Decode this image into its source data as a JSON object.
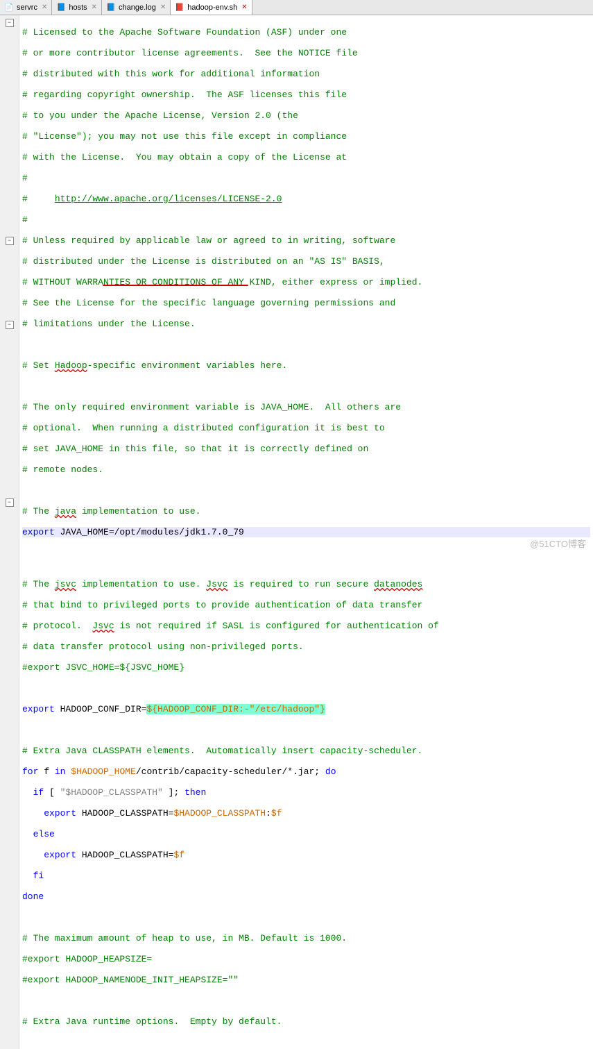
{
  "tabs": [
    {
      "label": "servrc",
      "active": false
    },
    {
      "label": "hosts",
      "active": false
    },
    {
      "label": "change.log",
      "active": false
    },
    {
      "label": "hadoop-env.sh",
      "active": true
    }
  ],
  "watermark": "@51CTO博客",
  "code": {
    "l1": "# Licensed to the Apache Software Foundation (ASF) under one",
    "l2": "# or more contributor license agreements.  See the NOTICE file",
    "l3": "# distributed with this work for additional information",
    "l4": "# regarding copyright ownership.  The ASF licenses this file",
    "l5": "# to you under the Apache License, Version 2.0 (the",
    "l6": "# \"License\"); you may not use this file except in compliance",
    "l7": "# with the License.  You may obtain a copy of the License at",
    "l8": "#",
    "l9a": "#     ",
    "l9b": "http://www.apache.org/licenses/LICENSE-2.0",
    "l10": "#",
    "l11": "# Unless required by applicable law or agreed to in writing, software",
    "l12": "# distributed under the License is distributed on an \"AS IS\" BASIS,",
    "l13": "# WITHOUT WARRANTIES OR CONDITIONS OF ANY KIND, either express or implied.",
    "l14": "# See the License for the specific language governing permissions and",
    "l15": "# limitations under the License.",
    "l17a": "# Set ",
    "l17b": "Hadoop",
    "l17c": "-specific environment variables here.",
    "l19": "# The only required environment variable is JAVA_HOME.  All others are",
    "l20": "# optional.  When running a distributed configuration it is best to",
    "l21": "# set JAVA_HOME in this file, so that it is correctly defined on",
    "l22": "# remote nodes.",
    "l24a": "# The ",
    "l24b": "java",
    "l24c": " implementation to use.",
    "l25a": "export",
    "l25b": " JAVA_HOME=/opt/modules/jdk1.7.0_79",
    "l27a": "# The ",
    "l27b": "jsvc",
    "l27c": " implementation to use. ",
    "l27d": "Jsvc",
    "l27e": " is required to run secure ",
    "l27f": "datanodes",
    "l28": "# that bind to privileged ports to provide authentication of data transfer",
    "l29a": "# protocol.  ",
    "l29b": "Jsvc",
    "l29c": " is not required if SASL is configured for authentication of",
    "l30": "# data transfer protocol using non-privileged ports.",
    "l31": "#export JSVC_HOME=${JSVC_HOME}",
    "l33a": "export",
    "l33b": " HADOOP_CONF_DIR=",
    "l33c": "${HADOOP_CONF_DIR:-\"/etc/hadoop\"}",
    "l35": "# Extra Java CLASSPATH elements.  Automatically insert capacity-scheduler.",
    "l36a": "for",
    "l36b": " f ",
    "l36c": "in",
    "l36d": " ",
    "l36e": "$HADOOP_HOME",
    "l36f": "/contrib/capacity-scheduler/*.jar; ",
    "l36g": "do",
    "l37a": "  if",
    "l37b": " [ ",
    "l37c": "\"$HADOOP_CLASSPATH\"",
    "l37d": " ]; ",
    "l37e": "then",
    "l38a": "    export",
    "l38b": " HADOOP_CLASSPATH=",
    "l38c": "$HADOOP_CLASSPATH",
    "l38d": ":",
    "l38e": "$f",
    "l39": "  else",
    "l40a": "    export",
    "l40b": " HADOOP_CLASSPATH=",
    "l40c": "$f",
    "l41": "  fi",
    "l42": "done",
    "l44": "# The maximum amount of heap to use, in MB. Default is 1000.",
    "l45": "#export HADOOP_HEAPSIZE=",
    "l46": "#export HADOOP_NAMENODE_INIT_HEAPSIZE=\"\"",
    "l48": "# Extra Java runtime options.  Empty by default."
  }
}
